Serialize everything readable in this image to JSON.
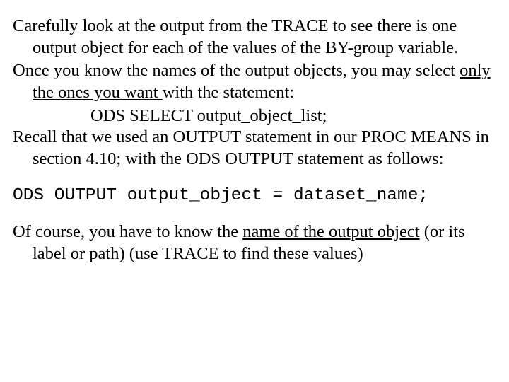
{
  "p1a": "Carefully look at the output from the TRACE to see there is one output object for each of the values of the BY-group variable.",
  "p2a": "Once you know the names of the output objects, you may select ",
  "p2u": "only the ones you want ",
  "p2b": "with the statement:",
  "code1": "ODS SELECT output_object_list;",
  "p3": "Recall that we used an OUTPUT statement in our PROC MEANS in section 4.10; with the ODS OUTPUT statement as follows:",
  "code2": "ODS OUTPUT output_object = dataset_name;",
  "p4a": "Of course, you have to know the ",
  "p4u": "name of the output object",
  "p4b": " (or its label or path) (use TRACE to find these values)"
}
